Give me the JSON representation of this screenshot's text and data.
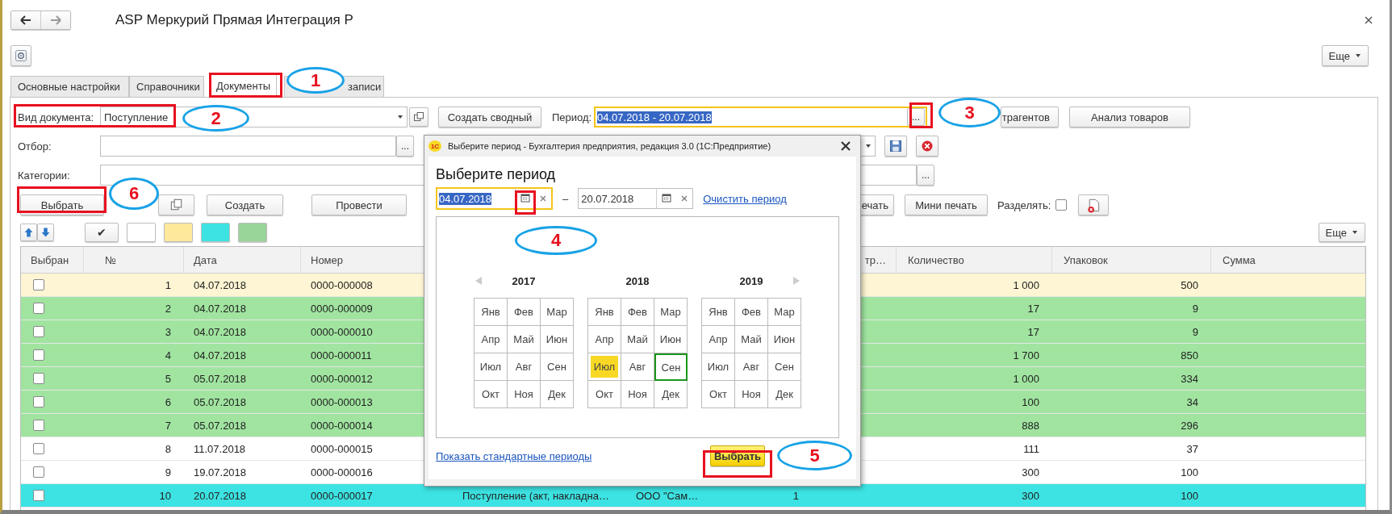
{
  "window": {
    "title": "ASP Меркурий Прямая Интеграция Р"
  },
  "header_buttons": {
    "more": "Еще"
  },
  "tabs": [
    {
      "label": "Основные настройки",
      "selected": false
    },
    {
      "label": "Справочники",
      "selected": false
    },
    {
      "label": "Документы",
      "selected": true
    },
    {
      "label": "записи",
      "selected": false
    }
  ],
  "form": {
    "doc_type_label": "Вид документа:",
    "doc_type_value": "Поступление",
    "create_summary": "Создать сводный",
    "period_label": "Период:",
    "period_value": "04.07.2018 - 20.07.2018",
    "period_focused": true,
    "period_text_selected": true,
    "period_button": "...",
    "counterparties_button": "трагентов",
    "goods_analysis_button": "Анализ товаров",
    "filter_label": "Отбор:",
    "filter_button": "...",
    "categories_label": "Категории:",
    "categories_button": "..."
  },
  "command_bar": {
    "choose": "Выбрать",
    "create": "Создать",
    "post": "Провести",
    "print": "ечать",
    "mini_print": "Мини печать",
    "split_label": "Разделять:",
    "split_checked": false
  },
  "color_bar": {
    "check": "✔",
    "colors": [
      {
        "color": "#ffffff"
      },
      {
        "color": "#fde89c"
      },
      {
        "color": "#3de3e3"
      },
      {
        "color": "#99d499"
      }
    ],
    "more": "Еще"
  },
  "table": {
    "columns": [
      "Выбран",
      "№",
      "Дата",
      "Номер",
      "тр…",
      "Количество",
      "Упаковок",
      "Сумма"
    ],
    "rows": [
      {
        "color": "#fdf5d3",
        "checked": false,
        "number": "1",
        "date": "04.07.2018",
        "doc_number": "0000-000008",
        "quantity": "1 000",
        "packages": "500"
      },
      {
        "color": "#a0e4a0",
        "checked": false,
        "number": "2",
        "date": "04.07.2018",
        "doc_number": "0000-000009",
        "quantity": "17",
        "packages": "9"
      },
      {
        "color": "#a0e4a0",
        "checked": false,
        "number": "3",
        "date": "04.07.2018",
        "doc_number": "0000-000010",
        "quantity": "17",
        "packages": "9"
      },
      {
        "color": "#a0e4a0",
        "checked": false,
        "number": "4",
        "date": "04.07.2018",
        "doc_number": "0000-000011",
        "quantity": "1 700",
        "packages": "850"
      },
      {
        "color": "#a0e4a0",
        "checked": false,
        "number": "5",
        "date": "05.07.2018",
        "doc_number": "0000-000012",
        "quantity": "1 000",
        "packages": "334"
      },
      {
        "color": "#a0e4a0",
        "checked": false,
        "number": "6",
        "date": "05.07.2018",
        "doc_number": "0000-000013",
        "quantity": "100",
        "packages": "34"
      },
      {
        "color": "#a0e4a0",
        "checked": false,
        "number": "7",
        "date": "05.07.2018",
        "doc_number": "0000-000014",
        "quantity": "888",
        "packages": "296"
      },
      {
        "color": "#ffffff",
        "checked": false,
        "number": "8",
        "date": "11.07.2018",
        "doc_number": "0000-000015",
        "quantity": "111",
        "packages": "37"
      },
      {
        "color": "#ffffff",
        "checked": false,
        "number": "9",
        "date": "19.07.2018",
        "doc_number": "0000-000016",
        "quantity": "300",
        "packages": "100"
      },
      {
        "color": "#3de3e3",
        "checked": false,
        "number": "10",
        "date": "20.07.2018",
        "doc_number": "0000-000017",
        "column_5": "Поступление (акт, накладна…",
        "column_6": "ООО \"Сам…",
        "column_7": "1",
        "quantity": "300",
        "packages": "100"
      }
    ]
  },
  "dialog": {
    "logo": "1С",
    "title": "Выберите период - Бухгалтерия предприятия, редакция 3.0  (1С:Предприятие)",
    "heading": "Выберите период",
    "date_from": "04.07.2018",
    "date_from_focused": true,
    "date_from_text_selected": true,
    "dash": "–",
    "date_to": "20.07.2018",
    "clear_link": "Очистить период",
    "years": [
      {
        "year": "2017",
        "months": [
          {
            "label": "Янв",
            "selected": false,
            "current": false
          },
          {
            "label": "Фев",
            "selected": false,
            "current": false
          },
          {
            "label": "Мар",
            "selected": false,
            "current": false
          },
          {
            "label": "Апр",
            "selected": false,
            "current": false
          },
          {
            "label": "Май",
            "selected": false,
            "current": false
          },
          {
            "label": "Июн",
            "selected": false,
            "current": false
          },
          {
            "label": "Июл",
            "selected": false,
            "current": false
          },
          {
            "label": "Авг",
            "selected": false,
            "current": false
          },
          {
            "label": "Сен",
            "selected": false,
            "current": false
          },
          {
            "label": "Окт",
            "selected": false,
            "current": false
          },
          {
            "label": "Ноя",
            "selected": false,
            "current": false
          },
          {
            "label": "Дек",
            "selected": false,
            "current": false
          }
        ]
      },
      {
        "year": "2018",
        "months": [
          {
            "label": "Янв",
            "selected": false,
            "current": false
          },
          {
            "label": "Фев",
            "selected": false,
            "current": false
          },
          {
            "label": "Мар",
            "selected": false,
            "current": false
          },
          {
            "label": "Апр",
            "selected": false,
            "current": false
          },
          {
            "label": "Май",
            "selected": false,
            "current": false
          },
          {
            "label": "Июн",
            "selected": false,
            "current": false
          },
          {
            "label": "Июл",
            "selected": true,
            "current": false
          },
          {
            "label": "Авг",
            "selected": false,
            "current": false
          },
          {
            "label": "Сен",
            "selected": false,
            "current": true
          },
          {
            "label": "Окт",
            "selected": false,
            "current": false
          },
          {
            "label": "Ноя",
            "selected": false,
            "current": false
          },
          {
            "label": "Дек",
            "selected": false,
            "current": false
          }
        ]
      },
      {
        "year": "2019",
        "months": [
          {
            "label": "Янв",
            "selected": false,
            "current": false
          },
          {
            "label": "Фев",
            "selected": false,
            "current": false
          },
          {
            "label": "Мар",
            "selected": false,
            "current": false
          },
          {
            "label": "Апр",
            "selected": false,
            "current": false
          },
          {
            "label": "Май",
            "selected": false,
            "current": false
          },
          {
            "label": "Июн",
            "selected": false,
            "current": false
          },
          {
            "label": "Июл",
            "selected": false,
            "current": false
          },
          {
            "label": "Авг",
            "selected": false,
            "current": false
          },
          {
            "label": "Сен",
            "selected": false,
            "current": false
          },
          {
            "label": "Окт",
            "selected": false,
            "current": false
          },
          {
            "label": "Ноя",
            "selected": false,
            "current": false
          },
          {
            "label": "Дек",
            "selected": false,
            "current": false
          }
        ]
      }
    ],
    "standard_periods_link": "Показать стандартные периоды",
    "choose_button": "Выбрать"
  },
  "annotations": [
    {
      "kind": "frame"
    },
    {
      "kind": "callout",
      "label": "1"
    },
    {
      "kind": "frame"
    },
    {
      "kind": "callout",
      "label": "2"
    },
    {
      "kind": "frame"
    },
    {
      "kind": "callout",
      "label": "3"
    },
    {
      "kind": "frame"
    },
    {
      "kind": "callout",
      "label": "4"
    },
    {
      "kind": "frame"
    },
    {
      "kind": "callout",
      "label": "5"
    },
    {
      "kind": "frame"
    },
    {
      "kind": "callout",
      "label": "6"
    }
  ]
}
